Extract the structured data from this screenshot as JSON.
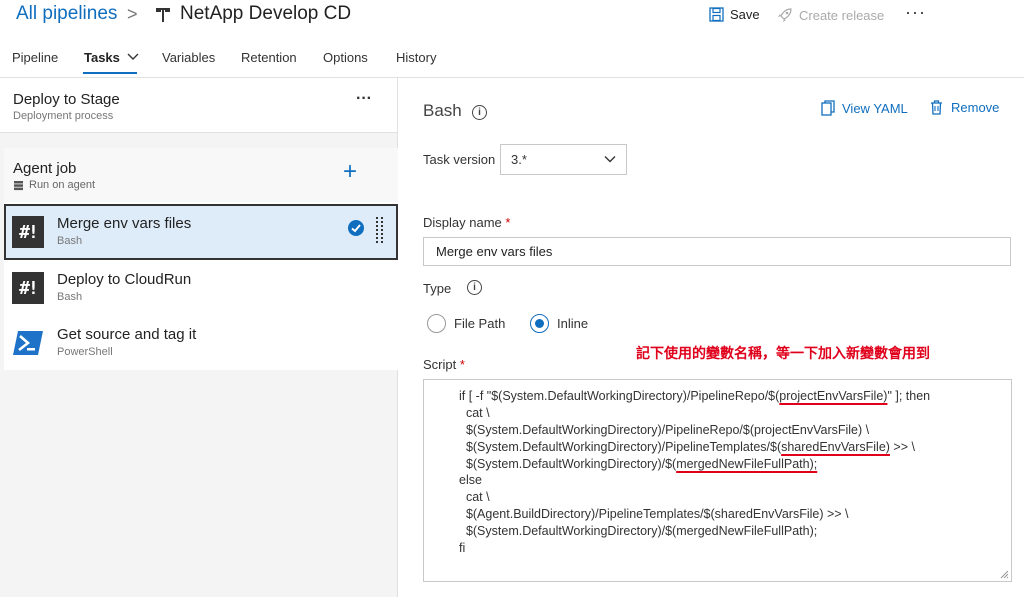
{
  "header": {
    "breadcrumb_link": "All pipelines",
    "breadcrumb_sep": ">",
    "pipeline_title": "NetApp Develop CD",
    "save_label": "Save",
    "create_release_label": "Create release",
    "more_label": "···"
  },
  "tabs": [
    {
      "label": "Pipeline"
    },
    {
      "label": "Tasks"
    },
    {
      "label": "Variables"
    },
    {
      "label": "Retention"
    },
    {
      "label": "Options"
    },
    {
      "label": "History"
    }
  ],
  "stage": {
    "title": "Deploy to Stage",
    "subtitle": "Deployment process",
    "more_label": "···"
  },
  "agent_job": {
    "title": "Agent job",
    "subtitle": "Run on agent",
    "add_label": "+"
  },
  "tasks": [
    {
      "name": "Merge env vars files",
      "type": "Bash",
      "icon": "bash-icon",
      "selected": true
    },
    {
      "name": "Deploy to CloudRun",
      "type": "Bash",
      "icon": "bash-icon",
      "selected": false
    },
    {
      "name": "Get source and tag it",
      "type": "PowerShell",
      "icon": "powershell-icon",
      "selected": false
    }
  ],
  "detail": {
    "title": "Bash",
    "view_yaml_label": "View YAML",
    "remove_label": "Remove",
    "task_version_label": "Task version",
    "task_version_value": "3.*",
    "display_name_label": "Display name",
    "display_name_value": "Merge env vars files",
    "type_label": "Type",
    "type_options": [
      "File Path",
      "Inline"
    ],
    "type_selected": "Inline",
    "script_label": "Script",
    "required_mark": "*",
    "annotation": "記下使用的變數名稱，等一下加入新變數會用到",
    "script_lines": [
      [
        "if [ -f \"$(System.DefaultWorkingDirectory)/PipelineRepo/$(",
        "projectEnvVarsFile)",
        "\" ]; then"
      ],
      [
        "  cat \\"
      ],
      [
        "  $(System.DefaultWorkingDirectory)/PipelineRepo/$(projectEnvVarsFile) \\"
      ],
      [
        "  $(System.DefaultWorkingDirectory)/PipelineTemplates/$(",
        "sharedEnvVarsFile)",
        " >> \\"
      ],
      [
        "  $(System.DefaultWorkingDirectory)/$(",
        "mergedNewFileFullPath);",
        ""
      ],
      [
        "else"
      ],
      [
        "  cat \\"
      ],
      [
        "  $(Agent.BuildDirectory)/PipelineTemplates/$(sharedEnvVarsFile) >> \\"
      ],
      [
        "  $(System.DefaultWorkingDirectory)/$(mergedNewFileFullPath);"
      ],
      [
        "fi"
      ]
    ]
  },
  "colors": {
    "accent": "#106ebe",
    "selected_bg": "#deecf9",
    "annotation": "#e0001b",
    "required": "#cc0000"
  }
}
